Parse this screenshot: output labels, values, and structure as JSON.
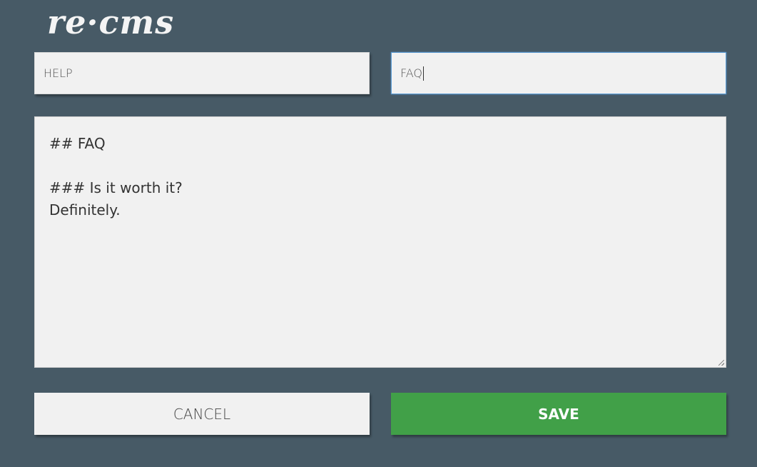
{
  "logo": {
    "text": "re·cms"
  },
  "form": {
    "section_field": {
      "value": "HELP"
    },
    "title_field": {
      "value": "FAQ"
    },
    "content": {
      "lines": [
        "## FAQ",
        "",
        "### Is it worth it?",
        "Definitely."
      ]
    }
  },
  "actions": {
    "cancel_label": "CANCEL",
    "save_label": "SAVE"
  },
  "colors": {
    "background": "#475a66",
    "field_bg": "#f1f1f1",
    "save_green": "#41a048",
    "focus_border": "#5d9dd6"
  }
}
